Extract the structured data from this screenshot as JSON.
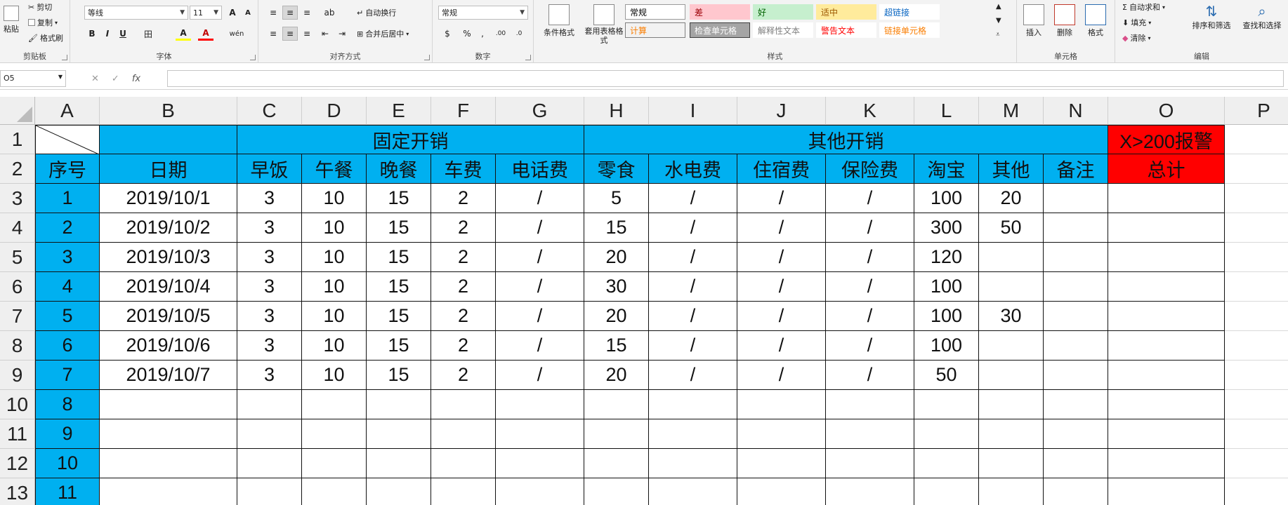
{
  "ribbon": {
    "clipboard": {
      "label": "剪贴板",
      "paste": "粘贴",
      "cut": "剪切",
      "copy": "复制",
      "format_painter": "格式刷"
    },
    "font": {
      "label": "字体",
      "name": "等线",
      "size": "11",
      "grow": "A",
      "shrink": "A",
      "bold": "B",
      "italic": "I",
      "underline": "U",
      "border": "田",
      "fill": "A",
      "color": "A",
      "phonetic": "wén"
    },
    "alignment": {
      "label": "对齐方式",
      "wrap": "自动换行",
      "merge": "合并后居中"
    },
    "number": {
      "label": "数字",
      "format": "常规",
      "currency": "$",
      "percent": "%",
      "comma": ",",
      "inc_dec": ".00",
      "dec_dec": ".0"
    },
    "styles": {
      "label": "样式",
      "conditional": "条件格式",
      "table_format": "套用表格格式",
      "cells": [
        {
          "text": "常规",
          "bg": "#ffffff",
          "fg": "#000000",
          "border": "#9a9a9a"
        },
        {
          "text": "差",
          "bg": "#ffc7ce",
          "fg": "#9c0006",
          "border": "#ffc7ce"
        },
        {
          "text": "好",
          "bg": "#c6efce",
          "fg": "#006100",
          "border": "#c6efce"
        },
        {
          "text": "适中",
          "bg": "#ffeb9c",
          "fg": "#9c5700",
          "border": "#ffeb9c"
        },
        {
          "text": "超链接",
          "bg": "#ffffff",
          "fg": "#0563c1",
          "border": "#ffffff"
        },
        {
          "text": "计算",
          "bg": "#f2f2f2",
          "fg": "#fa7d00",
          "border": "#7f7f7f"
        },
        {
          "text": "检查单元格",
          "bg": "#a5a5a5",
          "fg": "#ffffff",
          "border": "#3f3f3f"
        },
        {
          "text": "解释性文本",
          "bg": "#ffffff",
          "fg": "#7f7f7f",
          "border": "#ffffff"
        },
        {
          "text": "警告文本",
          "bg": "#ffffff",
          "fg": "#ff0000",
          "border": "#ffffff"
        },
        {
          "text": "链接单元格",
          "bg": "#ffffff",
          "fg": "#fa7d00",
          "border": "#ffffff"
        }
      ]
    },
    "cells": {
      "label": "单元格",
      "insert": "插入",
      "delete": "删除",
      "format": "格式"
    },
    "editing": {
      "label": "编辑",
      "autosum": "自动求和",
      "fill": "填充",
      "clear": "清除",
      "sort": "排序和筛选",
      "find": "查找和选择"
    }
  },
  "formula_bar": {
    "name_box": "O5",
    "cancel": "✕",
    "enter": "✓",
    "fx": "fx",
    "formula": ""
  },
  "columns": [
    "A",
    "B",
    "C",
    "D",
    "E",
    "F",
    "G",
    "H",
    "I",
    "J",
    "K",
    "L",
    "M",
    "N",
    "O",
    "P"
  ],
  "rows": [
    "1",
    "2",
    "3",
    "4",
    "5",
    "6",
    "7",
    "8",
    "9",
    "10",
    "11",
    "12",
    "13"
  ],
  "sheet": {
    "fixed_header": "固定开销",
    "other_header": "其他开销",
    "alarm_header": "X>200报警",
    "headers": [
      "序号",
      "日期",
      "早饭",
      "午餐",
      "晚餐",
      "车费",
      "电话费",
      "零食",
      "水电费",
      "住宿费",
      "保险费",
      "淘宝",
      "其他",
      "备注",
      "总计"
    ],
    "data": [
      [
        "1",
        "2019/10/1",
        "3",
        "10",
        "15",
        "2",
        "/",
        "5",
        "/",
        "/",
        "/",
        "100",
        "20",
        "",
        ""
      ],
      [
        "2",
        "2019/10/2",
        "3",
        "10",
        "15",
        "2",
        "/",
        "15",
        "/",
        "/",
        "/",
        "300",
        "50",
        "",
        ""
      ],
      [
        "3",
        "2019/10/3",
        "3",
        "10",
        "15",
        "2",
        "/",
        "20",
        "/",
        "/",
        "/",
        "120",
        "",
        "",
        ""
      ],
      [
        "4",
        "2019/10/4",
        "3",
        "10",
        "15",
        "2",
        "/",
        "30",
        "/",
        "/",
        "/",
        "100",
        "",
        "",
        ""
      ],
      [
        "5",
        "2019/10/5",
        "3",
        "10",
        "15",
        "2",
        "/",
        "20",
        "/",
        "/",
        "/",
        "100",
        "30",
        "",
        ""
      ],
      [
        "6",
        "2019/10/6",
        "3",
        "10",
        "15",
        "2",
        "/",
        "15",
        "/",
        "/",
        "/",
        "100",
        "",
        "",
        ""
      ],
      [
        "7",
        "2019/10/7",
        "3",
        "10",
        "15",
        "2",
        "/",
        "20",
        "/",
        "/",
        "/",
        "50",
        "",
        "",
        ""
      ],
      [
        "8",
        "",
        "",
        "",
        "",
        "",
        "",
        "",
        "",
        "",
        "",
        "",
        "",
        "",
        ""
      ],
      [
        "9",
        "",
        "",
        "",
        "",
        "",
        "",
        "",
        "",
        "",
        "",
        "",
        "",
        "",
        ""
      ],
      [
        "10",
        "",
        "",
        "",
        "",
        "",
        "",
        "",
        "",
        "",
        "",
        "",
        "",
        "",
        ""
      ],
      [
        "11",
        "",
        "",
        "",
        "",
        "",
        "",
        "",
        "",
        "",
        "",
        "",
        "",
        "",
        ""
      ]
    ]
  },
  "colors": {
    "header_blue": "#00b0f0",
    "alarm_red": "#ff0000"
  }
}
